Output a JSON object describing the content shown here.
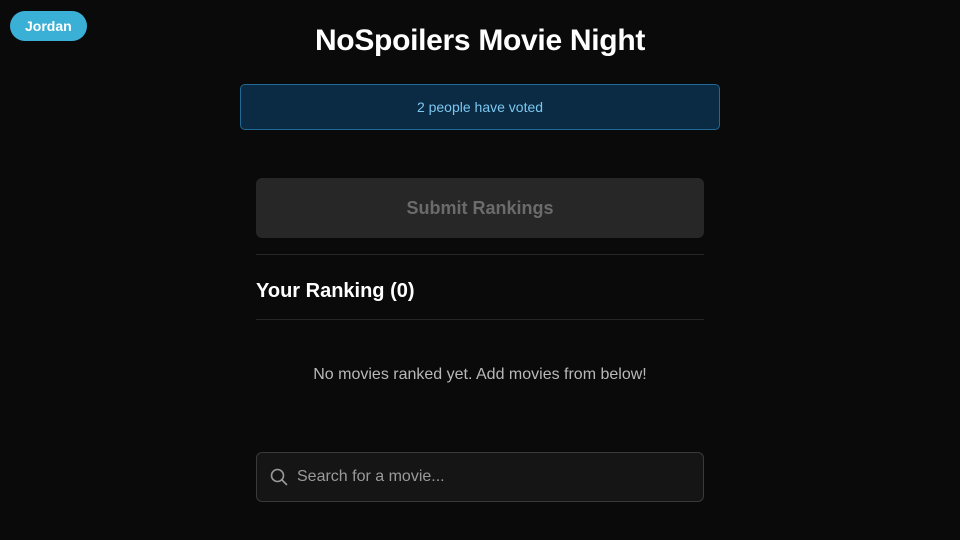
{
  "user": {
    "name": "Jordan"
  },
  "app": {
    "title": "NoSpoilers Movie Night"
  },
  "vote_status": {
    "text": "2 people have voted"
  },
  "actions": {
    "submit_label": "Submit Rankings"
  },
  "ranking": {
    "heading": "Your Ranking (0)",
    "empty_message": "No movies ranked yet. Add movies from below!"
  },
  "search": {
    "placeholder": "Search for a movie...",
    "value": "",
    "icon": "search-icon"
  },
  "colors": {
    "background": "#0a0a0a",
    "user_pill": "#3ab0d6",
    "banner_bg": "#0b2b44",
    "banner_border": "#1f6a96",
    "banner_text": "#7cc7ef",
    "disabled_button": "#272727"
  }
}
